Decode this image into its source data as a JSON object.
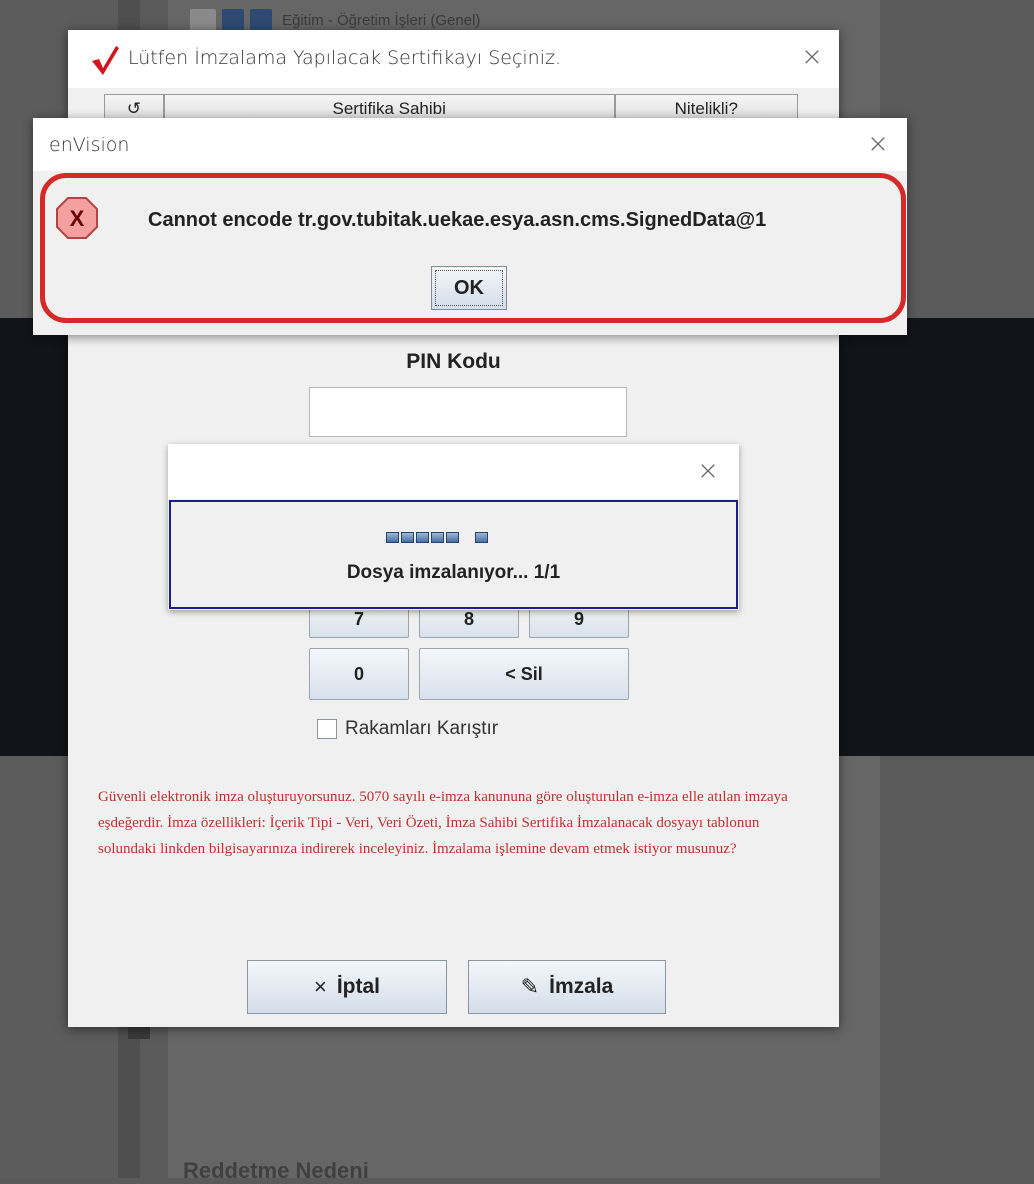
{
  "background": {
    "header_text": "Eğitim - Öğretim İşleri (Genel)",
    "footer_text": "Reddetme Nedeni"
  },
  "cert_dialog": {
    "title": "Lütfen İmzalama Yapılacak Sertifikayı Seçiniz.",
    "columns": [
      "↺",
      "Sertifika Sahibi",
      "Nitelikli?"
    ],
    "pin_label": "PIN Kodu",
    "pin_value": "",
    "keys": {
      "k7": "7",
      "k8": "8",
      "k9": "9",
      "k0": "0",
      "delete": "< Sil"
    },
    "shuffle_label": "Rakamları Karıştır",
    "shuffle_checked": false,
    "legal_text": "Güvenli elektronik imza oluşturuyorsunuz. 5070 sayılı e-imza kanununa göre oluşturulan e-imza elle atılan imzaya eşdeğerdir. İmza özellikleri: İçerik Tipi - Veri, Veri Özeti, İmza Sahibi Sertifika İmzalanacak dosyayı tablonun solundaki linkden bilgisayarınıza indirerek inceleyiniz. İmzalama işlemine devam etmek istiyor musunuz?",
    "cancel_label": "İptal",
    "cancel_icon": "×",
    "sign_label": "İmzala",
    "sign_icon": "✎"
  },
  "progress_dialog": {
    "title": "",
    "status_text": "Dosya imzalanıyor... 1/1"
  },
  "error_dialog": {
    "title": "enVision",
    "icon_glyph": "X",
    "message": "Cannot encode tr.gov.tubitak.uekae.esya.asn.cms.SignedData@1",
    "ok_label": "OK"
  },
  "colors": {
    "error_highlight": "#d42a2a",
    "legal_text": "#c03030",
    "progress_border": "#1c1c8a",
    "check_mark": "#d3141b"
  }
}
